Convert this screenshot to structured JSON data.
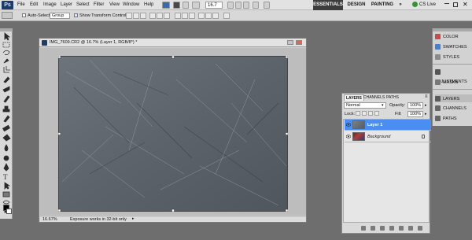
{
  "app": {
    "logo": "Ps"
  },
  "menu": [
    {
      "id": "file",
      "label": "File"
    },
    {
      "id": "edit",
      "label": "Edit"
    },
    {
      "id": "image",
      "label": "Image"
    },
    {
      "id": "layer",
      "label": "Layer"
    },
    {
      "id": "select",
      "label": "Select"
    },
    {
      "id": "filter",
      "label": "Filter"
    },
    {
      "id": "view",
      "label": "View"
    },
    {
      "id": "window",
      "label": "Window"
    },
    {
      "id": "help",
      "label": "Help"
    }
  ],
  "zoom_select": "16.7",
  "workspaces": {
    "essentials": "ESSENTIALS",
    "design": "DESIGN",
    "painting": "PAINTING"
  },
  "cs_live": "CS Live",
  "options": {
    "auto_select_label": "Auto-Select:",
    "auto_select_value": "Group",
    "show_transform_label": "Show Transform Controls"
  },
  "document": {
    "title": "IMG_7609.CR2 @ 16.7% (Layer 1, RGB/8*) *",
    "zoom": "16.67%",
    "status": "Exposure works in 32-bit only"
  },
  "dock": {
    "color": "COLOR",
    "swatches": "SWATCHES",
    "styles": "STYLES",
    "adjustments": "ADJUSTMENTS",
    "masks": "MASKS",
    "layers": "LAYERS",
    "channels": "CHANNELS",
    "paths": "PATHS"
  },
  "layers_panel": {
    "tabs": [
      "LAYERS",
      "CHANNELS",
      "PATHS"
    ],
    "blend_mode": "Normal",
    "opacity_label": "Opacity:",
    "opacity_value": "100%",
    "lock_label": "Lock:",
    "fill_label": "Fill:",
    "fill_value": "100%",
    "layers": [
      {
        "name": "Layer 1",
        "selected": true
      },
      {
        "name": "Background",
        "selected": false
      }
    ]
  },
  "colors": {
    "selected_layer": "#4b8ef2",
    "workspace_bg": "#6e6e6e",
    "ps_logo": "#1e3b6a"
  }
}
